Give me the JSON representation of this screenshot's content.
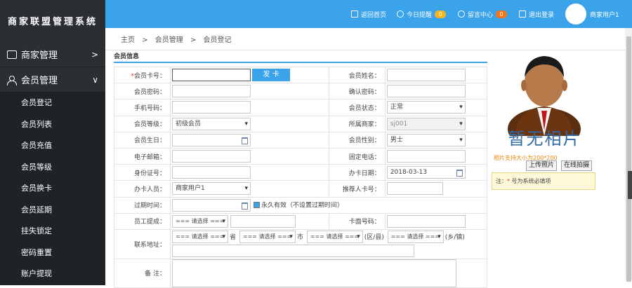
{
  "brand": "商家联盟管理系统",
  "sidebar": {
    "groups": [
      {
        "label": "商家管理",
        "chevron": ">"
      },
      {
        "label": "会员管理",
        "chevron": "∨"
      }
    ],
    "items": [
      "会员登记",
      "会员列表",
      "会员充值",
      "会员等级",
      "会员换卡",
      "会员延期",
      "挂失锁定",
      "密码重置",
      "账户提现"
    ]
  },
  "topbar": {
    "home": "返回首页",
    "today": "今日提醒",
    "today_count": "0",
    "messages": "留言中心",
    "messages_count": "0",
    "logout": "退出登录",
    "user": "商家用户1"
  },
  "breadcrumb": {
    "items": [
      "主页",
      ">",
      "会员管理",
      ">",
      "会员登记"
    ]
  },
  "section_title": "会员信息",
  "form": {
    "card_no_label": "会员卡号：",
    "issue_card": "发 卡",
    "name_label": "会员姓名：",
    "password_label": "会员密码：",
    "confirm_password_label": "确认密码：",
    "phone_label": "手机号码：",
    "status_label": "会员状态：",
    "status_value": "正常",
    "level_label": "会员等级：",
    "level_value": "初级会员",
    "merchant_label": "所属商家：",
    "merchant_value": "sj001",
    "birthday_label": "会员生日：",
    "gender_label": "会员性别：",
    "gender_value": "男士",
    "email_label": "电子邮箱：",
    "tel_label": "固定电话：",
    "id_label": "身份证号：",
    "issue_date_label": "办卡日期：",
    "issue_date_value": "2018-03-13",
    "operator_label": "办卡人员：",
    "operator_value": "商家用户1",
    "referrer_label": "推荐人卡号：",
    "expire_label": "过期时间：",
    "permanent_label": "永久有效（不设置过期时间）",
    "commission_label": "员工提成：",
    "commission_select": "=== 请选择 ===",
    "card_face_label": "卡面号码：",
    "address_label": "联系地址：",
    "province_select": "=== 请选择 ===",
    "province_unit": "省",
    "city_select": "=== 请选择 ===",
    "city_unit": "市",
    "district_select": "=== 请选择 ===",
    "district_unit": "(区/县)",
    "town_select": "=== 请选择 ===",
    "town_unit": "(乡/镇)",
    "remark_label": "备 注："
  },
  "photo": {
    "placeholder": "暂无相片",
    "size_note": "相片支持大小为200*200",
    "upload": "上传照片",
    "camera": "在线拍摄"
  },
  "note": {
    "prefix": "注：",
    "star": "*",
    "text": " 号为系统必填项"
  },
  "colors": {
    "topbar": "#3aa3ea",
    "sidebar": "#2b2f33",
    "accent": "#3aa3ea",
    "badge_today": "#f7b51c",
    "badge_msg": "#f7741c"
  }
}
